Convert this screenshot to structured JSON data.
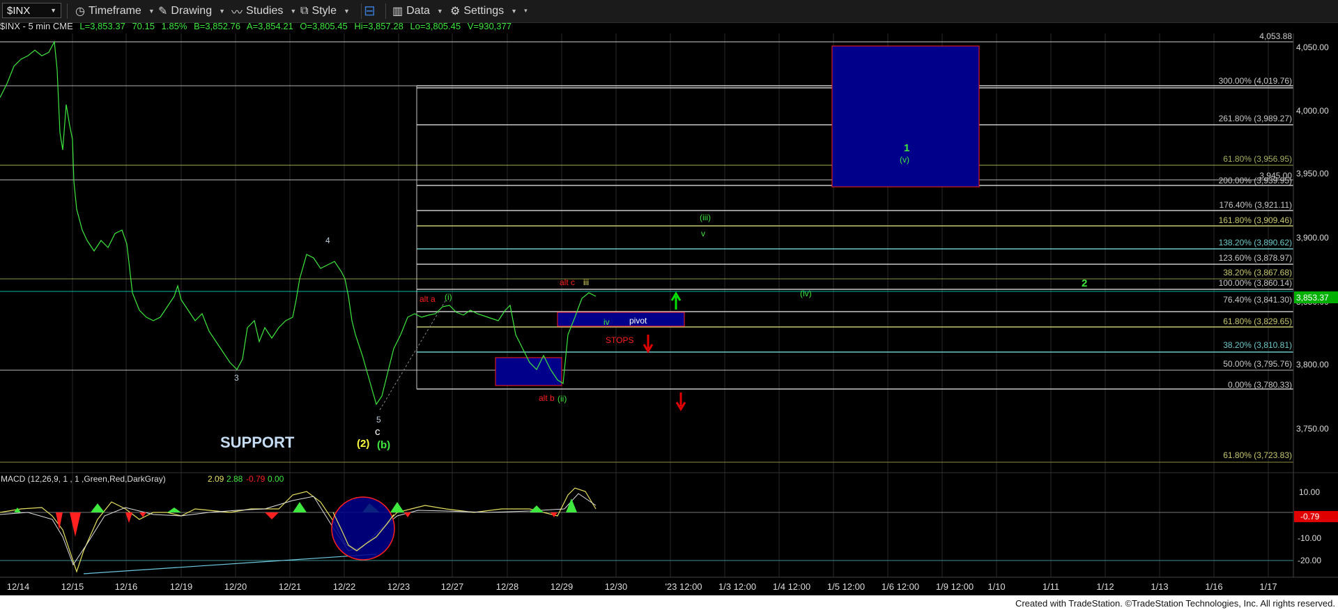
{
  "toolbar": {
    "symbol": "$INX",
    "timeframe": "Timeframe",
    "drawing": "Drawing",
    "studies": "Studies",
    "style": "Style",
    "data": "Data",
    "settings": "Settings"
  },
  "info": {
    "symbol": "$INX - 5 min",
    "exchange": "CME",
    "last": "L=3,853.37",
    "change": "70.15",
    "pct": "1.85%",
    "bid": "B=3,852.76",
    "ask": "A=3,854.21",
    "open": "O=3,805.45",
    "high": "Hi=3,857.28",
    "low": "Lo=3,805.45",
    "volume": "V=930,377"
  },
  "colors": {
    "price": "#3ee83e",
    "fib": "#c8c8c8",
    "box": "#00008b",
    "boxBorder": "#ff2020",
    "accent": "#00c800"
  },
  "price_axis": [
    "4,050.00",
    "4,000.00",
    "3,950.00",
    "3,900.00",
    "3,850.00",
    "3,800.00",
    "3,750.00"
  ],
  "current_price": "3,853.37",
  "top_level": "4,053.88",
  "fib_labels": [
    {
      "text": "300.00% (4,019.76)",
      "color": "#c8c8c8"
    },
    {
      "text": "261.80% (3,989.27)",
      "color": "#c8c8c8"
    },
    {
      "text": "61.80% (3,956.95)",
      "color": "#a8b060"
    },
    {
      "text": "3,945.00",
      "color": "#c8c8c8"
    },
    {
      "text": "200.00% (3,939.95)",
      "color": "#c8c8c8"
    },
    {
      "text": "176.40% (3,921.11)",
      "color": "#c8c8c8"
    },
    {
      "text": "161.80% (3,909.46)",
      "color": "#c8c870"
    },
    {
      "text": "138.20% (3,890.62)",
      "color": "#6ec8c8"
    },
    {
      "text": "123.60% (3,878.97)",
      "color": "#c8c8c8"
    },
    {
      "text": "38.20% (3,867.68)",
      "color": "#c8c870"
    },
    {
      "text": "100.00% (3,860.14)",
      "color": "#c8c8c8"
    },
    {
      "text": "76.40% (3,841.30)",
      "color": "#c8c8c8"
    },
    {
      "text": "61.80% (3,829.65)",
      "color": "#c8c870"
    },
    {
      "text": "38.20% (3,810.81)",
      "color": "#6ec8c8"
    },
    {
      "text": "50.00% (3,795.76)",
      "color": "#c8c8c8"
    },
    {
      "text": "0.00% (3,780.33)",
      "color": "#c8c8c8"
    },
    {
      "text": "61.80% (3,723.83)",
      "color": "#c8c870"
    }
  ],
  "annotations": {
    "support": "SUPPORT",
    "pivot": "pivot",
    "stops": "STOPS",
    "w1": "1",
    "wv": "(v)",
    "w2": "2",
    "w3": "3",
    "w4": "4",
    "w5": "5",
    "wc": "c",
    "w2p": "(2)",
    "wb": "(b)",
    "alta": "alt a",
    "wi": "(i)",
    "altb": "alt b",
    "wii": "(ii)",
    "altc": "alt c",
    "iii": "iii",
    "iv": "iv",
    "wiii": "(iii)",
    "v": "v",
    "wiv": "(iv)"
  },
  "macd": {
    "label": "MACD (12,26,9, 1 , 1 ,Green,Red,DarkGray)",
    "v1": "2.09",
    "v2": "2.88",
    "v3": "-0.79",
    "v4": "0.00",
    "axis": [
      "10.00",
      "-10.00",
      "-20.00"
    ],
    "current": "-0.79"
  },
  "xaxis": [
    "12/14",
    "12/15",
    "12/16",
    "12/19",
    "12/20",
    "12/21",
    "12/22",
    "12/23",
    "12/27",
    "12/28",
    "12/29",
    "12/30",
    "'23 12:00",
    "1/3 12:00",
    "1/4 12:00",
    "1/5 12:00",
    "1/6 12:00",
    "1/9 12:00",
    "1/10",
    "1/11",
    "1/12",
    "1/13",
    "1/16",
    "1/17"
  ],
  "footer": "Created with TradeStation. ©TradeStation Technologies, Inc. All rights reserved."
}
